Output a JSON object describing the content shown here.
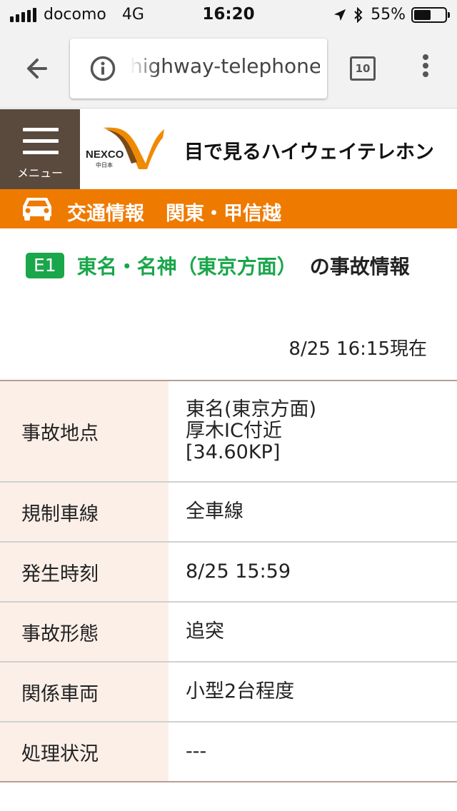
{
  "status_bar": {
    "carrier": "docomo",
    "network": "4G",
    "time": "16:20",
    "battery": "55%",
    "battery_level": 0.55
  },
  "browser": {
    "url": "highway-telephone.jp",
    "tab_count": "10"
  },
  "header": {
    "menu_label": "メニュー",
    "logo_brand": "NEXCO",
    "logo_sub": "中日本",
    "site_title": "目で見るハイウェイテレホン"
  },
  "category": {
    "section": "交通情報",
    "region": "関東・甲信越"
  },
  "incident": {
    "route_code": "E1",
    "route_name": "東名・名神（東京方面）",
    "heading_suffix": "の事故情報",
    "timestamp": "8/25 16:15現在"
  },
  "details": [
    {
      "label": "事故地点",
      "value": [
        "東名(東京方面)",
        "厚木IC付近",
        "[34.60KP]"
      ]
    },
    {
      "label": "規制車線",
      "value": [
        "全車線"
      ]
    },
    {
      "label": "発生時刻",
      "value": [
        "8/25 15:59"
      ]
    },
    {
      "label": "事故形態",
      "value": [
        "追突"
      ]
    },
    {
      "label": "関係車両",
      "value": [
        "小型2台程度"
      ]
    },
    {
      "label": "処理状況",
      "value": [
        "---"
      ]
    }
  ],
  "colors": {
    "orange": "#ef7a00",
    "green": "#1aa64b",
    "menu_brown": "#5a4a3e",
    "label_bg": "#fcefe8"
  }
}
